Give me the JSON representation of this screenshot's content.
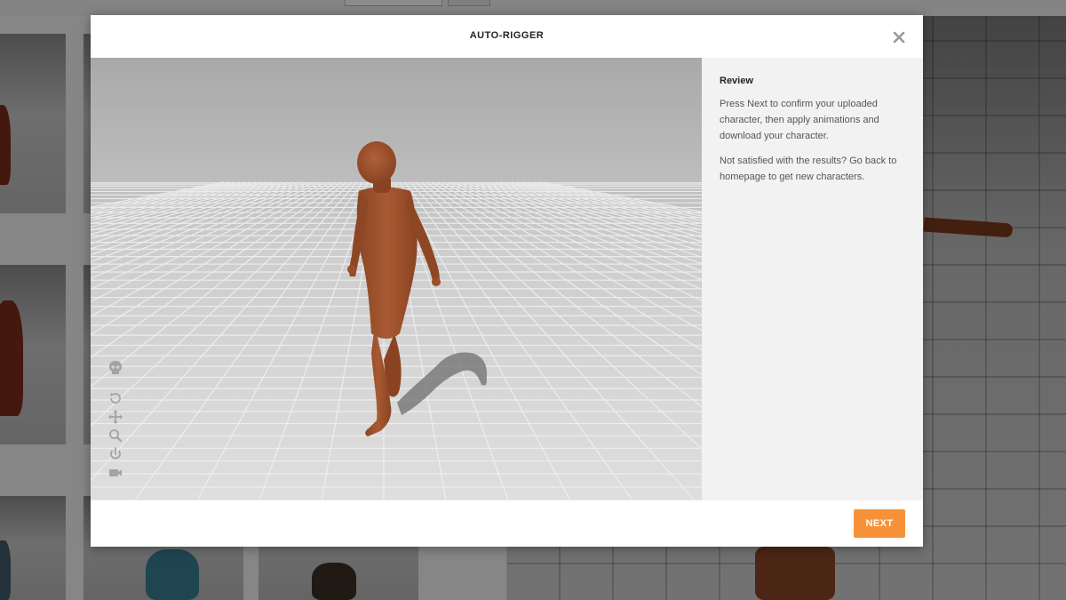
{
  "modal": {
    "title": "AUTO-RIGGER",
    "close_icon": "close-icon"
  },
  "review_panel": {
    "heading": "Review",
    "paragraph_1": "Press Next to confirm your uploaded character, then apply animations and download your character.",
    "paragraph_2": "Not satisfied with the results? Go back to homepage to get new characters."
  },
  "viewer_tools": [
    {
      "icon": "skeleton-icon"
    },
    {
      "icon": "rotate-icon"
    },
    {
      "icon": "pan-icon"
    },
    {
      "icon": "zoom-icon"
    },
    {
      "icon": "power-icon"
    },
    {
      "icon": "camera-icon"
    }
  ],
  "footer": {
    "next_label": "NEXT"
  },
  "colors": {
    "accent": "#f7923a",
    "character": "#a2552f",
    "panel_bg": "#f2f2f2"
  }
}
